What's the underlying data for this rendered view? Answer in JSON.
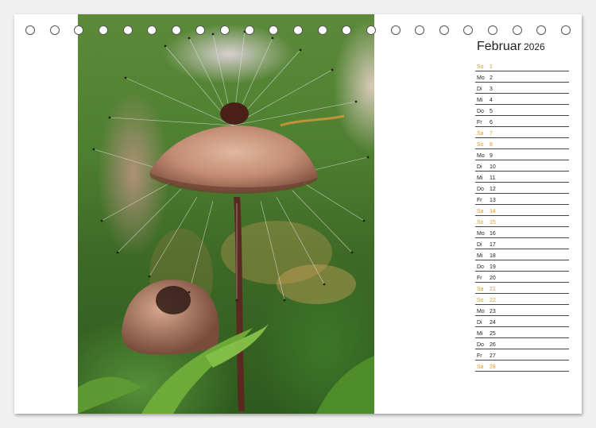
{
  "calendar": {
    "month": "Februar",
    "year": "2026",
    "weekend_color": "#e39a1e",
    "days": [
      {
        "wd": "So",
        "num": "1",
        "weekend": true
      },
      {
        "wd": "Mo",
        "num": "2",
        "weekend": false
      },
      {
        "wd": "Di",
        "num": "3",
        "weekend": false
      },
      {
        "wd": "Mi",
        "num": "4",
        "weekend": false
      },
      {
        "wd": "Do",
        "num": "5",
        "weekend": false
      },
      {
        "wd": "Fr",
        "num": "6",
        "weekend": false
      },
      {
        "wd": "Sa",
        "num": "7",
        "weekend": true
      },
      {
        "wd": "So",
        "num": "8",
        "weekend": true
      },
      {
        "wd": "Mo",
        "num": "9",
        "weekend": false
      },
      {
        "wd": "Di",
        "num": "10",
        "weekend": false
      },
      {
        "wd": "Mi",
        "num": "11",
        "weekend": false
      },
      {
        "wd": "Do",
        "num": "12",
        "weekend": false
      },
      {
        "wd": "Fr",
        "num": "13",
        "weekend": false
      },
      {
        "wd": "Sa",
        "num": "14",
        "weekend": true
      },
      {
        "wd": "So",
        "num": "15",
        "weekend": true
      },
      {
        "wd": "Mo",
        "num": "16",
        "weekend": false
      },
      {
        "wd": "Di",
        "num": "17",
        "weekend": false
      },
      {
        "wd": "Mi",
        "num": "18",
        "weekend": false
      },
      {
        "wd": "Do",
        "num": "19",
        "weekend": false
      },
      {
        "wd": "Fr",
        "num": "20",
        "weekend": false
      },
      {
        "wd": "Sa",
        "num": "21",
        "weekend": true
      },
      {
        "wd": "So",
        "num": "22",
        "weekend": true
      },
      {
        "wd": "Mo",
        "num": "23",
        "weekend": false
      },
      {
        "wd": "Di",
        "num": "24",
        "weekend": false
      },
      {
        "wd": "Mi",
        "num": "25",
        "weekend": false
      },
      {
        "wd": "Do",
        "num": "26",
        "weekend": false
      },
      {
        "wd": "Fr",
        "num": "27",
        "weekend": false
      },
      {
        "wd": "Sa",
        "num": "28",
        "weekend": true
      }
    ]
  },
  "binding": {
    "hole_count": 23
  }
}
